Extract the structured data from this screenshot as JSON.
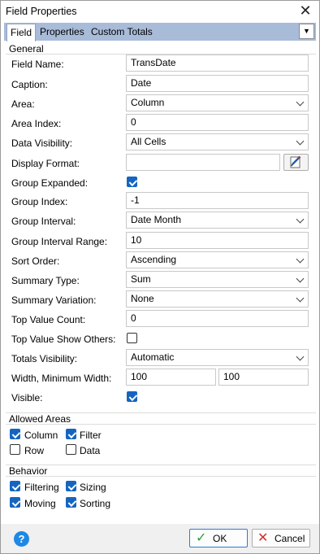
{
  "window": {
    "title": "Field Properties",
    "close_glyph": "✕"
  },
  "tabs": [
    "Field",
    "Properties",
    "Custom Totals"
  ],
  "tab_dropdown_glyph": "▼",
  "general": {
    "caption": "General",
    "rows": {
      "field_name": {
        "label": "Field Name:",
        "value": "TransDate"
      },
      "caption": {
        "label": "Caption:",
        "value": "Date"
      },
      "area": {
        "label": "Area:",
        "value": "Column"
      },
      "area_index": {
        "label": "Area Index:",
        "value": "0"
      },
      "data_visibility": {
        "label": "Data Visibility:",
        "value": "All Cells"
      },
      "display_format": {
        "label": "Display Format:",
        "value": ""
      },
      "group_expanded": {
        "label": "Group Expanded:",
        "checked": true
      },
      "group_index": {
        "label": "Group Index:",
        "value": "-1"
      },
      "group_interval": {
        "label": "Group Interval:",
        "value": "Date Month"
      },
      "group_interval_range": {
        "label": "Group Interval Range:",
        "value": "10"
      },
      "sort_order": {
        "label": "Sort Order:",
        "value": "Ascending"
      },
      "summary_type": {
        "label": "Summary Type:",
        "value": "Sum"
      },
      "summary_variation": {
        "label": "Summary Variation:",
        "value": "None"
      },
      "top_value_count": {
        "label": "Top Value Count:",
        "value": "0"
      },
      "top_value_show_others": {
        "label": "Top Value Show Others:",
        "checked": false
      },
      "totals_visibility": {
        "label": "Totals Visibility:",
        "value": "Automatic"
      },
      "width": {
        "label": "Width, Minimum Width:",
        "value": "100",
        "min_value": "100"
      },
      "visible": {
        "label": "Visible:",
        "checked": true
      }
    }
  },
  "allowed_areas": {
    "caption": "Allowed Areas",
    "items": {
      "column": {
        "label": "Column",
        "checked": true
      },
      "filter": {
        "label": "Filter",
        "checked": true
      },
      "row": {
        "label": "Row",
        "checked": false
      },
      "data": {
        "label": "Data",
        "checked": false
      }
    }
  },
  "behavior": {
    "caption": "Behavior",
    "items": {
      "filtering": {
        "label": "Filtering",
        "checked": true
      },
      "sizing": {
        "label": "Sizing",
        "checked": true
      },
      "moving": {
        "label": "Moving",
        "checked": true
      },
      "sorting": {
        "label": "Sorting",
        "checked": true
      }
    }
  },
  "footer": {
    "help_glyph": "?",
    "ok_label": "OK",
    "ok_glyph": "✓",
    "cancel_label": "Cancel",
    "cancel_glyph": "✕"
  },
  "colors": {
    "accent": "#1565c0",
    "tab_strip": "#a8bcd9",
    "ok_check": "#2e9d3a",
    "cancel_x": "#d32f2f"
  }
}
